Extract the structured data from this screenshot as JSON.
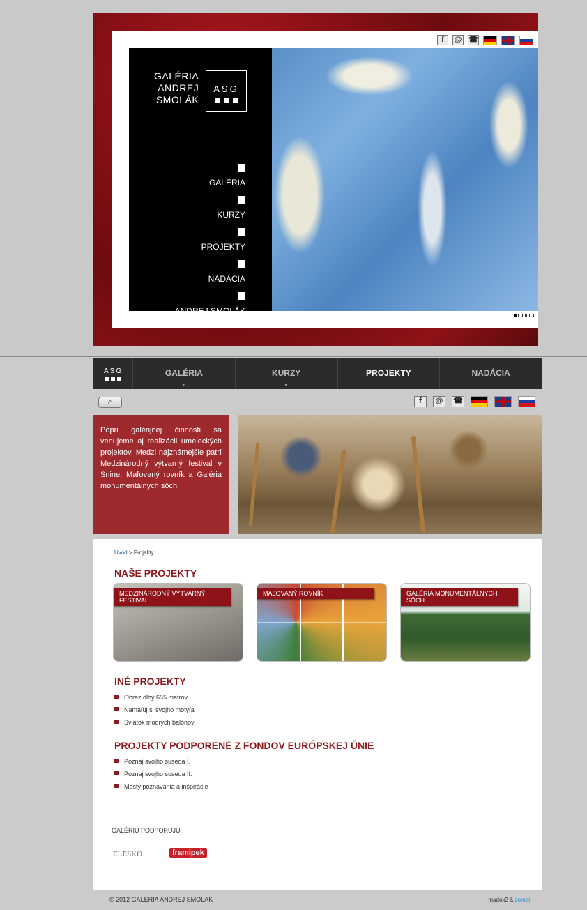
{
  "hero": {
    "logo_lines": [
      "GALÉRIA",
      "ANDREJ",
      "SMOLÁK"
    ],
    "logo_badge": "ASG",
    "menu": [
      "GALÉRIA",
      "KURZY",
      "PROJEKTY",
      "NADÁCIA",
      "ANDREJ SMOLÁK"
    ],
    "top_icons": [
      "facebook-icon",
      "email-icon",
      "phone-icon",
      "german-flag-icon",
      "uk-flag-icon",
      "slovak-flag-icon"
    ],
    "slide_count": 5,
    "active_slide": 1
  },
  "nav": {
    "logo": "ASG",
    "items": [
      "GALÉRIA",
      "KURZY",
      "PROJEKTY",
      "NADÁCIA"
    ],
    "active": "PROJEKTY"
  },
  "intro": {
    "text": "Popri galérijnej činnosti sa venujeme aj realizácii umeleckých projektov. Medzi najznámejšie patrí Medzinárodný výtvarný festival v Snine, Maľovaný rovník a Galéria monumentálnych sôch."
  },
  "breadcrumb": {
    "home": "Úvod",
    "current": "> Projekty"
  },
  "sections": {
    "our_projects": "NAŠE PROJEKTY",
    "other_projects": "INÉ PROJEKTY",
    "eu_projects": "PROJEKTY PODPORENÉ Z FONDOV EURÓPSKEJ ÚNIE"
  },
  "cards": [
    {
      "title": "MEDZINÁRODNÝ VÝTVARNÝ FESTIVAL"
    },
    {
      "title": "MAĽOVANÝ ROVNÍK"
    },
    {
      "title": "GALÉRIA MONUMENTÁLNYCH SÔCH"
    }
  ],
  "other_list": [
    "Obraz dlhý 655 metrov",
    "Namaľuj si svojho motýľa",
    "Sviatok modrých balónov"
  ],
  "eu_list": [
    "Poznaj svojho suseda I.",
    "Poznaj svojho suseda II.",
    "Mosty poznávania a inšpirácie"
  ],
  "supporters": {
    "label": "GALÉRIU PODPORUJÚ:",
    "items": [
      "ELESKO",
      "framipek"
    ]
  },
  "footer": {
    "copyright": "© 2012 GALERIA ANDREJ SMOLAK",
    "credit1": "madox2 &",
    "credit2": "zombi"
  },
  "colors": {
    "accent_red": "#8b1a1f",
    "intro_red": "#9e2a2e",
    "nav_dark": "#2b2b2b"
  }
}
